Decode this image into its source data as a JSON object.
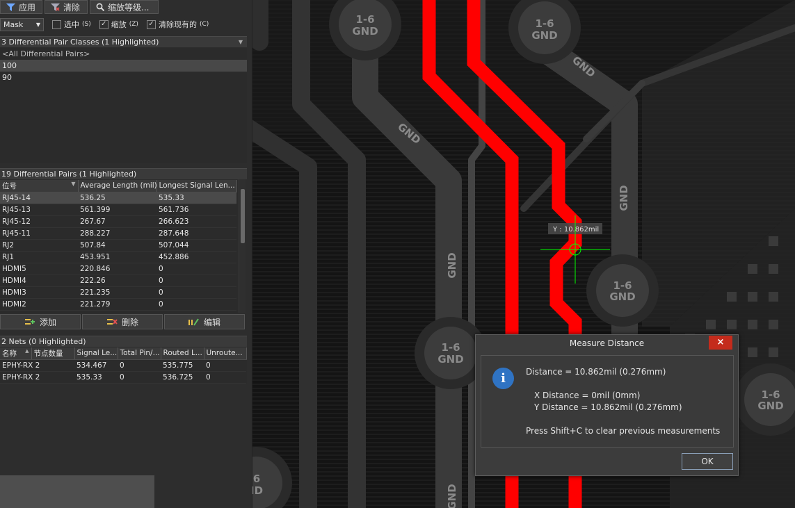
{
  "toolbar": {
    "apply": "应用",
    "clear": "清除",
    "zoom_level": "缩放等级..."
  },
  "options": {
    "mask_select": "Mask",
    "select_check": "选中",
    "select_key": "(S)",
    "zoom_check": "缩放",
    "zoom_key": "(Z)",
    "clear_existing_check": "清除现有的",
    "clear_existing_key": "(C)"
  },
  "pair_classes": {
    "header": "3 Differential Pair Classes (1 Highlighted)",
    "items": [
      "<All Differential Pairs>",
      "100",
      "90"
    ]
  },
  "pairs": {
    "header": "19 Differential Pairs (1 Highlighted)",
    "columns": [
      "位号",
      "Average Length (mil)",
      "Longest Signal Len..."
    ],
    "rows": [
      [
        "RJ45-14",
        "536.25",
        "535.33"
      ],
      [
        "RJ45-13",
        "561.399",
        "561.736"
      ],
      [
        "RJ45-12",
        "267.67",
        "266.623"
      ],
      [
        "RJ45-11",
        "288.227",
        "287.648"
      ],
      [
        "RJ2",
        "507.84",
        "507.044"
      ],
      [
        "RJ1",
        "453.951",
        "452.886"
      ],
      [
        "HDMI5",
        "220.846",
        "0"
      ],
      [
        "HDMI4",
        "222.26",
        "0"
      ],
      [
        "HDMI3",
        "221.235",
        "0"
      ],
      [
        "HDMI2",
        "221.279",
        "0"
      ]
    ]
  },
  "actions": {
    "add": "添加",
    "delete": "删除",
    "edit": "编辑"
  },
  "nets": {
    "header": "2 Nets (0 Highlighted)",
    "columns": [
      "名称",
      "节点数量",
      "Signal Le...",
      "Total Pin/...",
      "Routed L...",
      "Unroute..."
    ],
    "rows": [
      [
        "EPHY-RX 2",
        "",
        "534.467",
        "0",
        "535.775",
        "0"
      ],
      [
        "EPHY-RX 2",
        "",
        "535.33",
        "0",
        "536.725",
        "0"
      ]
    ]
  },
  "pcb": {
    "pad_label_top": "1-6",
    "pad_label_bottom": "GND",
    "trace_label": "GND",
    "pad_label_cut_top": "6",
    "pad_label_cut_bottom": "ID",
    "measure_tooltip": "Y : 10.862mil",
    "trace_color": "#ff0000",
    "cursor_color": "#00ff00"
  },
  "dialog": {
    "title": "Measure Distance",
    "close": "×",
    "distance": "Distance = 10.862mil (0.276mm)",
    "x_distance": "X Distance = 0mil (0mm)",
    "y_distance": "Y Distance = 10.862mil (0.276mm)",
    "hint": "Press Shift+C to clear previous measurements",
    "ok": "OK",
    "info_glyph": "i"
  }
}
